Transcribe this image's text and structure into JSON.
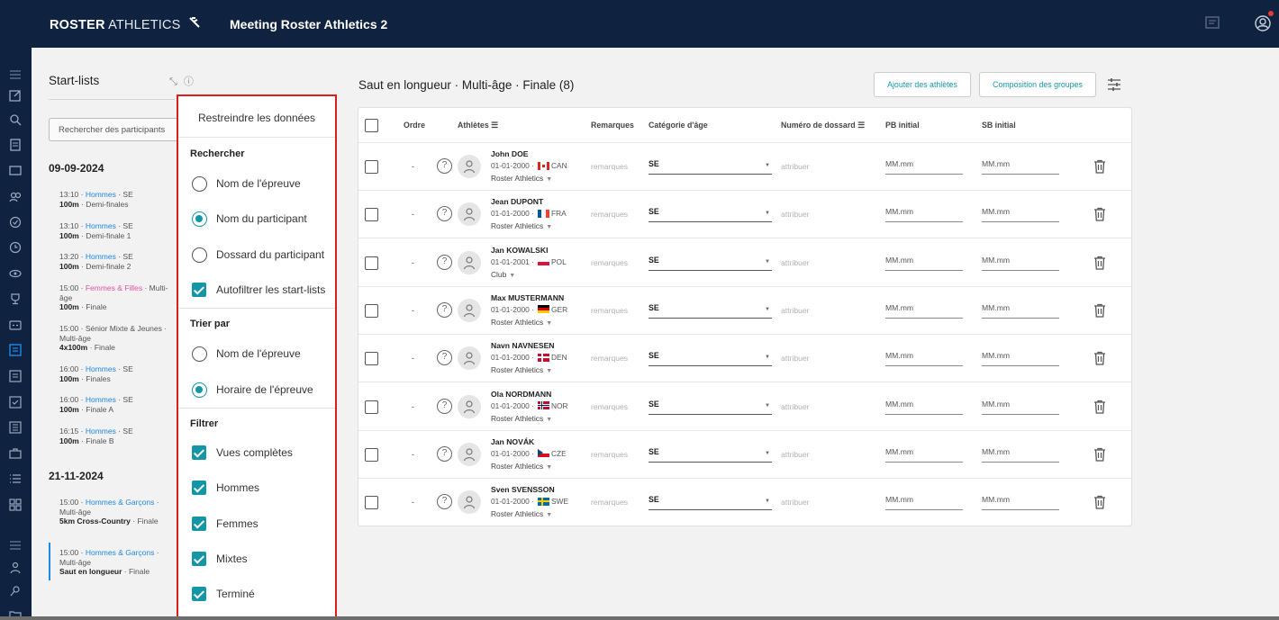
{
  "topbar": {
    "brand_bold": "ROSTER",
    "brand_light": "ATHLETICS",
    "meeting_title": "Meeting Roster Athletics 2",
    "colors": {
      "background": "#0f2340",
      "notification": "#e53935"
    }
  },
  "sidebar": {
    "header": "Start-lists",
    "search_placeholder": "Rechercher des participants",
    "dates": [
      {
        "label": "09-09-2024"
      },
      {
        "label": "21-11-2024"
      }
    ],
    "events": [
      {
        "time": "13:10 · ",
        "group": "Hommes",
        "age": " · SE",
        "event": "100m",
        "round": " · Demi-finales"
      },
      {
        "time": "13:10 · ",
        "group": "Hommes",
        "age": " · SE",
        "event": "100m",
        "round": " · Demi-finale 1"
      },
      {
        "time": "13:20 · ",
        "group": "Hommes",
        "age": " · SE",
        "event": "100m",
        "round": " · Demi-finale 2"
      },
      {
        "time": "15:00 · ",
        "group": "Femmes & Filles",
        "age": " · Multi-âge",
        "event": "100m",
        "round": " · Finale"
      },
      {
        "time": "15:00 · Sénior Mixte & Jeunes · Multi-âge",
        "event": "4x100m",
        "round": " · Finale"
      },
      {
        "time": "16:00 · ",
        "group": "Hommes",
        "age": " · SE",
        "event": "100m",
        "round": " · Finales"
      },
      {
        "time": "16:00 · ",
        "group": "Hommes",
        "age": " · SE",
        "event": "100m",
        "round": " · Finale A"
      },
      {
        "time": "16:15 · ",
        "group": "Hommes",
        "age": " · SE",
        "event": "100m",
        "round": " · Finale B"
      },
      {
        "time": "15:00 · ",
        "group": "Hommes & Garçons",
        "age": " · Multi-âge",
        "event": "5km Cross-Country",
        "round": " · Finale"
      },
      {
        "time": "15:00 · ",
        "group": "Hommes & Garçons",
        "age": " · Multi-âge",
        "event": "Saut en longueur",
        "round": " · Finale"
      }
    ]
  },
  "filter_panel": {
    "title": "Restreindre les données",
    "search_section": "Rechercher",
    "search_options": [
      {
        "label": "Nom de l'épreuve",
        "selected": false
      },
      {
        "label": "Nom du participant",
        "selected": true
      },
      {
        "label": "Dossard du participant",
        "selected": false
      }
    ],
    "autofilter_label": "Autofiltrer les start-lists",
    "sort_section": "Trier par",
    "sort_options": [
      {
        "label": "Nom de l'épreuve",
        "selected": false
      },
      {
        "label": "Horaire de l'épreuve",
        "selected": true
      }
    ],
    "filter_section": "Filtrer",
    "filters": [
      {
        "label": "Vues complètes",
        "checked": true
      },
      {
        "label": "Hommes",
        "checked": true
      },
      {
        "label": "Femmes",
        "checked": true
      },
      {
        "label": "Mixtes",
        "checked": true
      },
      {
        "label": "Terminé",
        "checked": true
      }
    ],
    "accent_color": "#1596a7",
    "highlight_border": "#d9201f"
  },
  "main": {
    "title": "Saut en longueur · Multi-âge · Finale (8)",
    "add_athletes_button": "Ajouter des athlètes",
    "groups_button": "Composition des groupes",
    "columns": {
      "order": "Ordre",
      "athletes": "Athlètes",
      "remarks": "Remarques",
      "age_category": "Catégorie d'âge",
      "bib": "Numéro de dossard",
      "pb": "PB initial",
      "sb": "SB initial"
    },
    "rows": [
      {
        "order": "-",
        "name": "John DOE",
        "dob": "01-01-2000 ·",
        "country": "CAN",
        "club": "Roster Athletics",
        "remark": "remarques",
        "age": "SE",
        "bib": "attribuer",
        "pb": "MM.mm",
        "sb": "MM.mm"
      },
      {
        "order": "-",
        "name": "Jean DUPONT",
        "dob": "01-01-2000 ·",
        "country": "FRA",
        "club": "Roster Athletics",
        "remark": "remarques",
        "age": "SE",
        "bib": "attribuer",
        "pb": "MM.mm",
        "sb": "MM.mm"
      },
      {
        "order": "-",
        "name": "Jan KOWALSKI",
        "dob": "01-01-2001 ·",
        "country": "POL",
        "club": "Club",
        "remark": "remarques",
        "age": "SE",
        "bib": "attribuer",
        "pb": "MM.mm",
        "sb": "MM.mm"
      },
      {
        "order": "-",
        "name": "Max MUSTERMANN",
        "dob": "01-01-2000 ·",
        "country": "GER",
        "club": "Roster Athletics",
        "remark": "remarques",
        "age": "SE",
        "bib": "attribuer",
        "pb": "MM.mm",
        "sb": "MM.mm"
      },
      {
        "order": "-",
        "name": "Navn NAVNESEN",
        "dob": "01-01-2000 ·",
        "country": "DEN",
        "club": "Roster Athletics",
        "remark": "remarques",
        "age": "SE",
        "bib": "attribuer",
        "pb": "MM.mm",
        "sb": "MM.mm"
      },
      {
        "order": "-",
        "name": "Ola NORDMANN",
        "dob": "01-01-2000 ·",
        "country": "NOR",
        "club": "Roster Athletics",
        "remark": "remarques",
        "age": "SE",
        "bib": "attribuer",
        "pb": "MM.mm",
        "sb": "MM.mm"
      },
      {
        "order": "-",
        "name": "Jan NOVÁK",
        "dob": "01-01-2000 ·",
        "country": "CZE",
        "club": "Roster Athletics",
        "remark": "remarques",
        "age": "SE",
        "bib": "attribuer",
        "pb": "MM.mm",
        "sb": "MM.mm"
      },
      {
        "order": "-",
        "name": "Sven SVENSSON",
        "dob": "01-01-2000 ·",
        "country": "SWE",
        "club": "Roster Athletics",
        "remark": "remarques",
        "age": "SE",
        "bib": "attribuer",
        "pb": "MM.mm",
        "sb": "MM.mm"
      }
    ]
  }
}
